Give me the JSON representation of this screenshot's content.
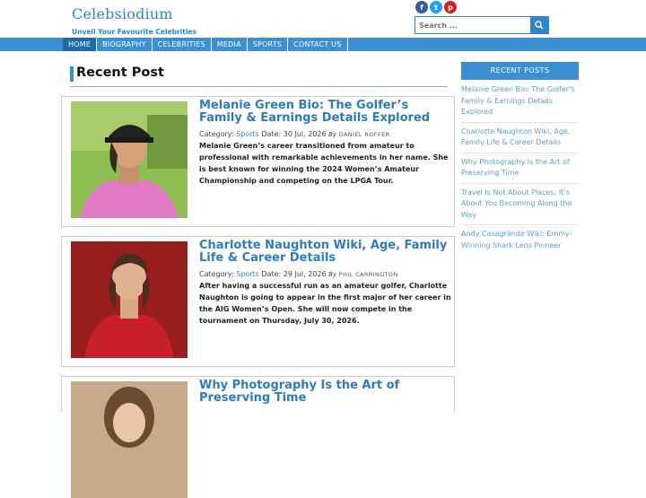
{
  "site": {
    "logo": "Celebsiodium",
    "tagline": "Unveil Your Favourite Celebrities"
  },
  "social": [
    {
      "name": "facebook",
      "glyph": "f"
    },
    {
      "name": "twitter",
      "glyph": "t"
    },
    {
      "name": "pinterest",
      "glyph": "p"
    }
  ],
  "search": {
    "placeholder": "Search ..."
  },
  "nav": [
    "HOME",
    "BIOGRAPHY",
    "CELEBRITIES",
    "MEDIA",
    "SPORTS",
    "CONTACT US"
  ],
  "nav_active": "HOME",
  "main": {
    "section_title": "Recent Post",
    "posts": [
      {
        "title": "Melanie Green Bio: The Golfer’s Family & Earnings Details Explored",
        "category_label": "Category:",
        "category": "Sports",
        "date_label": "Date:",
        "date": "30 Jul, 2026",
        "by": "By",
        "author": "DANIEL ROFFER",
        "excerpt": "Melanie Green’s career transitioned from amateur to professional with remarkable achievements in her name. She is best known for winning the 2024 Women’s Amateur Championship and competing on the LPGA Tour."
      },
      {
        "title": "Charlotte Naughton Wiki, Age, Family Life & Career Details",
        "category_label": "Category:",
        "category": "Sports",
        "date_label": "Date:",
        "date": "29 Jul, 2026",
        "by": "By",
        "author": "PHIL CARRINGTON",
        "excerpt": "After having a successful run as an amateur golfer, Charlotte Naughton is going to appear in the first major of her career in the AIG Women’s Open. She will now compete in the tournament on Thursday, July 30, 2026."
      },
      {
        "title": "Why Photography Is the Art of Preserving Time"
      }
    ]
  },
  "sidebar": {
    "heading": "RECENT POSTS",
    "items": [
      "Melanie Green Bio: The Golfer’s Family & Earnings Details Explored",
      "Charlotte Naughton Wiki, Age, Family Life & Career Details",
      "Why Photography Is the Art of Preserving Time",
      "Travel Is Not About Places; It’s About You Becoming Along the Way",
      "Andy Casagrande Wiki: Emmy-Winning Shark Lens Pioneer"
    ]
  },
  "colors": {
    "accent": "#3b8fd2",
    "link": "#2e7bbd",
    "nav_active": "#1d6aa8"
  }
}
